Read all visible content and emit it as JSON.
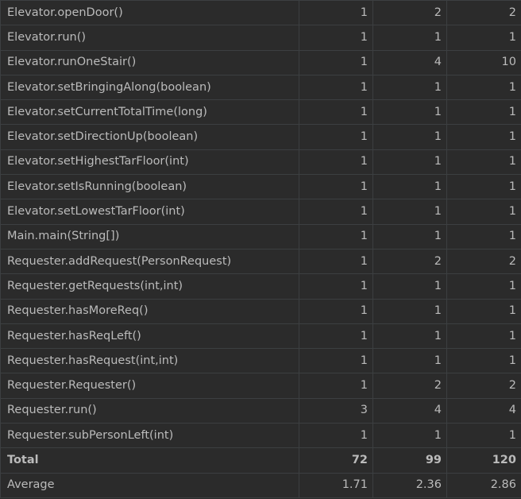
{
  "rows": [
    {
      "method": "Elevator.openDoor()",
      "v1": "1",
      "v2": "2",
      "v3": "2"
    },
    {
      "method": "Elevator.run()",
      "v1": "1",
      "v2": "1",
      "v3": "1"
    },
    {
      "method": "Elevator.runOneStair()",
      "v1": "1",
      "v2": "4",
      "v3": "10"
    },
    {
      "method": "Elevator.setBringingAlong(boolean)",
      "v1": "1",
      "v2": "1",
      "v3": "1"
    },
    {
      "method": "Elevator.setCurrentTotalTime(long)",
      "v1": "1",
      "v2": "1",
      "v3": "1"
    },
    {
      "method": "Elevator.setDirectionUp(boolean)",
      "v1": "1",
      "v2": "1",
      "v3": "1"
    },
    {
      "method": "Elevator.setHighestTarFloor(int)",
      "v1": "1",
      "v2": "1",
      "v3": "1"
    },
    {
      "method": "Elevator.setIsRunning(boolean)",
      "v1": "1",
      "v2": "1",
      "v3": "1"
    },
    {
      "method": "Elevator.setLowestTarFloor(int)",
      "v1": "1",
      "v2": "1",
      "v3": "1"
    },
    {
      "method": "Main.main(String[])",
      "v1": "1",
      "v2": "1",
      "v3": "1"
    },
    {
      "method": "Requester.addRequest(PersonRequest)",
      "v1": "1",
      "v2": "2",
      "v3": "2"
    },
    {
      "method": "Requester.getRequests(int,int)",
      "v1": "1",
      "v2": "1",
      "v3": "1"
    },
    {
      "method": "Requester.hasMoreReq()",
      "v1": "1",
      "v2": "1",
      "v3": "1"
    },
    {
      "method": "Requester.hasReqLeft()",
      "v1": "1",
      "v2": "1",
      "v3": "1"
    },
    {
      "method": "Requester.hasRequest(int,int)",
      "v1": "1",
      "v2": "1",
      "v3": "1"
    },
    {
      "method": "Requester.Requester()",
      "v1": "1",
      "v2": "2",
      "v3": "2"
    },
    {
      "method": "Requester.run()",
      "v1": "3",
      "v2": "4",
      "v3": "4"
    },
    {
      "method": "Requester.subPersonLeft(int)",
      "v1": "1",
      "v2": "1",
      "v3": "1"
    }
  ],
  "total": {
    "label": "Total",
    "v1": "72",
    "v2": "99",
    "v3": "120"
  },
  "average": {
    "label": "Average",
    "v1": "1.71",
    "v2": "2.36",
    "v3": "2.86"
  }
}
